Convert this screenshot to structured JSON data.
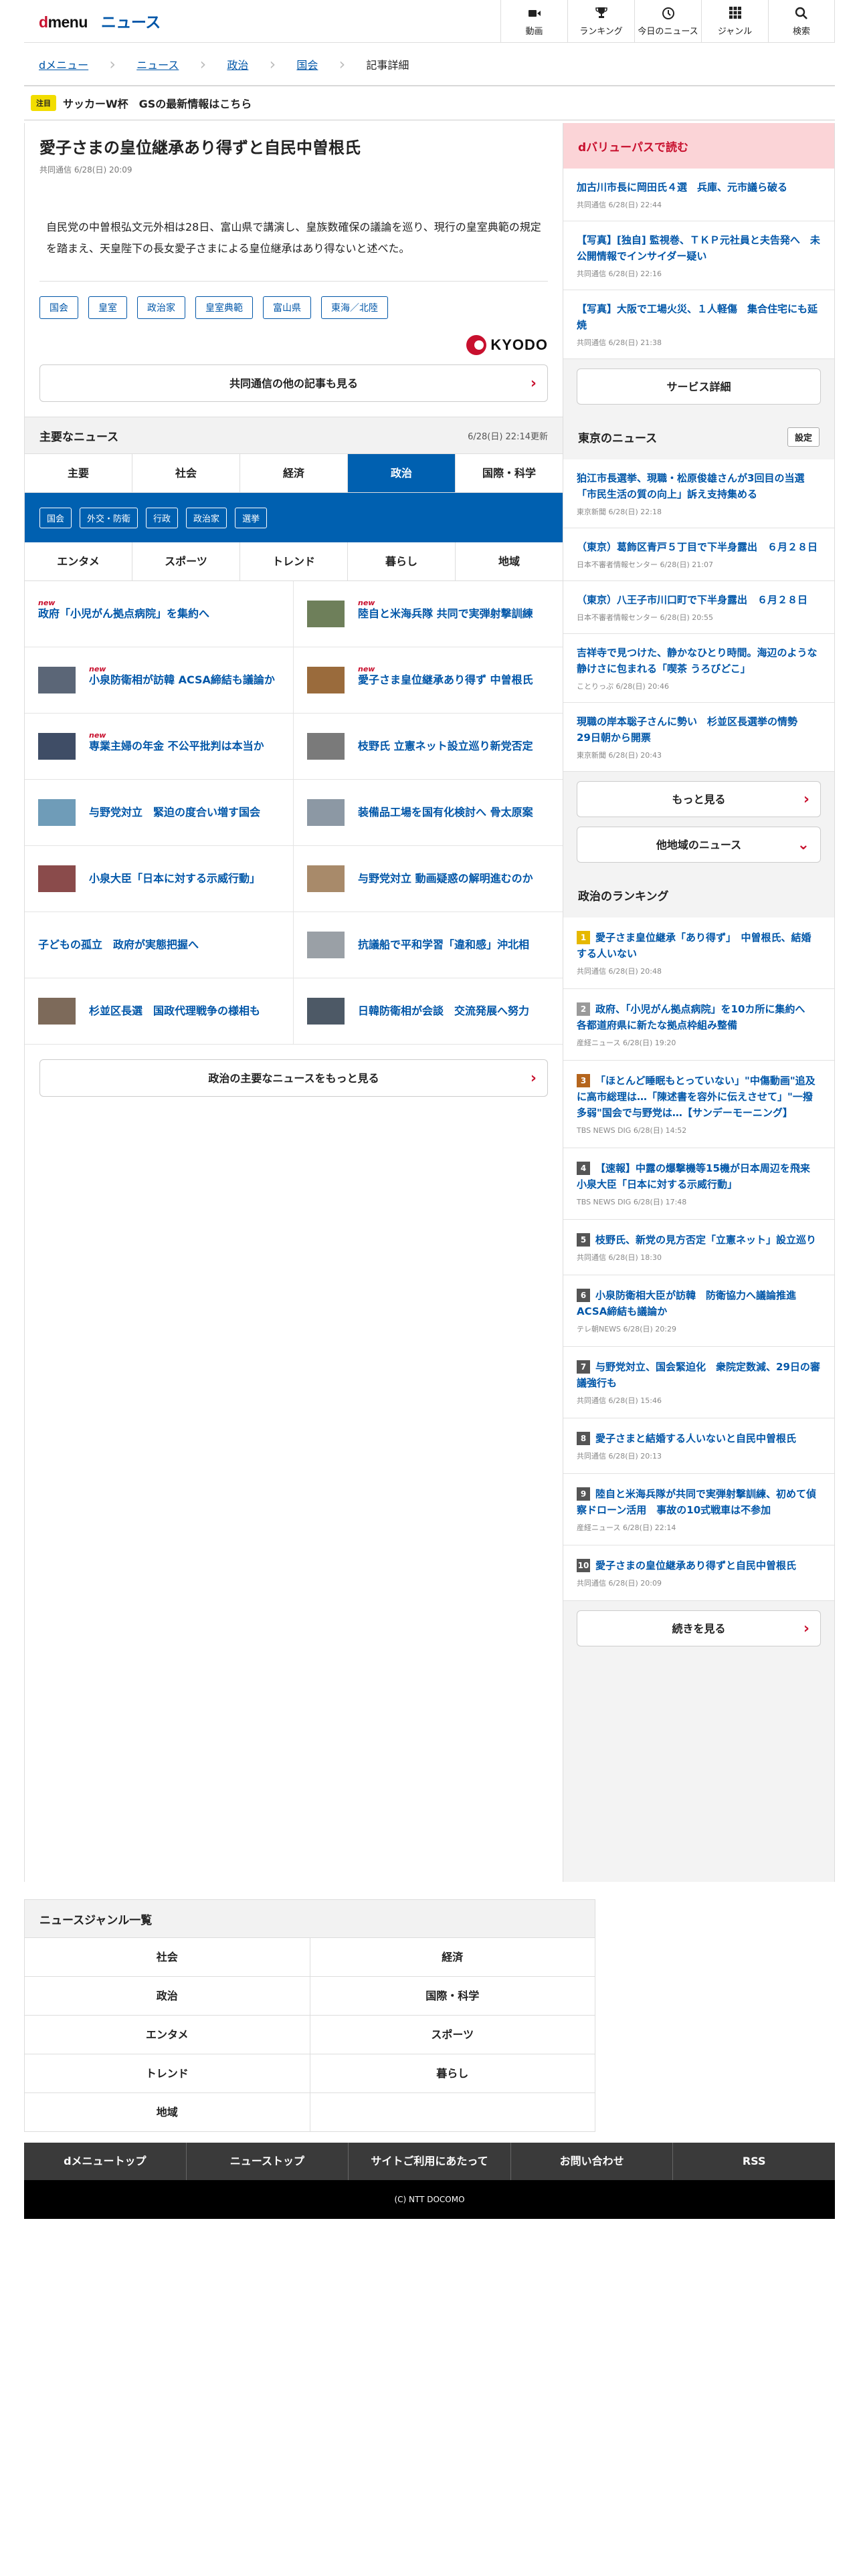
{
  "header": {
    "logo_d": "d",
    "logo_menu": "menu",
    "service": "ニュース",
    "nav": [
      {
        "icon": "video-icon",
        "label": "動画"
      },
      {
        "icon": "trophy-icon",
        "label": "ランキング"
      },
      {
        "icon": "clock-icon",
        "label": "今日のニュース"
      },
      {
        "icon": "grid-icon",
        "label": "ジャンル"
      },
      {
        "icon": "search-icon",
        "label": "検索"
      }
    ]
  },
  "breadcrumb": [
    "dメニュー",
    "ニュース",
    "政治",
    "国会",
    "記事詳細"
  ],
  "notice": {
    "tag": "注目",
    "text": "サッカーW杯　GSの最新情報はこちら"
  },
  "article": {
    "title": "愛子さまの皇位継承あり得ずと自民中曽根氏",
    "meta": "共同通信 6/28(日) 20:09",
    "lead": "自民党の中曽根弘文元外相は28日、富山県で講演し、皇族数確保の議論を巡り、現行の皇室典範の規定を踏まえ、天皇陛下の長女愛子さまによる皇位継承はあり得ないと述べた。",
    "tags": [
      "国会",
      "皇室",
      "政治家",
      "皇室典範",
      "富山県",
      "東海／北陸"
    ],
    "provider_logo": "KYODO",
    "more_button": "共同通信の他の記事も見る"
  },
  "main_news": {
    "title": "主要なニュース",
    "updated": "6/28(日) 22:14更新",
    "tabs1": [
      "主要",
      "社会",
      "経済",
      "政治",
      "国際・科学"
    ],
    "active_tab": "政治",
    "subtags": [
      "国会",
      "外交・防衛",
      "行政",
      "政治家",
      "選挙"
    ],
    "tabs2": [
      "エンタメ",
      "スポーツ",
      "トレンド",
      "暮らし",
      "地域"
    ],
    "items": [
      {
        "title": "政府「小児がん拠点病院」を集約へ",
        "new": "new",
        "thumb": false,
        "color": ""
      },
      {
        "title": "陸自と米海兵隊 共同で実弾射撃訓練",
        "new": "new",
        "thumb": true,
        "color": "#6e7f5a"
      },
      {
        "title": "小泉防衛相が訪韓 ACSA締結も議論か",
        "new": "new",
        "thumb": true,
        "color": "#5b6677"
      },
      {
        "title": "愛子さま皇位継承あり得ず 中曽根氏",
        "new": "new",
        "thumb": true,
        "color": "#9a6b3c"
      },
      {
        "title": "専業主婦の年金 不公平批判は本当か",
        "new": "new",
        "thumb": true,
        "color": "#3f4d66"
      },
      {
        "title": "枝野氏 立憲ネット設立巡り新党否定",
        "new": "",
        "thumb": true,
        "color": "#7a7a7a"
      },
      {
        "title": "与野党対立　緊迫の度合い増す国会",
        "new": "",
        "thumb": true,
        "color": "#6f9cb8"
      },
      {
        "title": "装備品工場を国有化検討へ 骨太原案",
        "new": "",
        "thumb": true,
        "color": "#8c98a4"
      },
      {
        "title": "小泉大臣「日本に対する示威行動」",
        "new": "",
        "thumb": true,
        "color": "#8a4b4b"
      },
      {
        "title": "与野党対立 動画疑惑の解明進むのか",
        "new": "",
        "thumb": true,
        "color": "#a88a6a"
      },
      {
        "title": "子どもの孤立　政府が実態把握へ",
        "new": "",
        "thumb": false,
        "color": ""
      },
      {
        "title": "抗議船で平和学習「違和感」沖北相",
        "new": "",
        "thumb": true,
        "color": "#9aa0a6"
      },
      {
        "title": "杉並区長選　国政代理戦争の様相も",
        "new": "",
        "thumb": true,
        "color": "#7d6a5a"
      },
      {
        "title": "日韓防衛相が会談　交流発展へ努力",
        "new": "",
        "thumb": true,
        "color": "#4d5966"
      }
    ],
    "more_button": "政治の主要なニュースをもっと見る"
  },
  "dvalue": {
    "title": "dバリューパスで読む",
    "items": [
      {
        "title": "加古川市長に岡田氏４選　兵庫、元市議ら破る",
        "meta": "共同通信 6/28(日) 22:44"
      },
      {
        "title": "【写真】[独自] 監視巻、ＴＫＰ元社員と夫告発へ　未公開情報でインサイダー疑い",
        "meta": "共同通信 6/28(日) 22:16"
      },
      {
        "title": "【写真】大阪で工場火災、１人軽傷　集合住宅にも延焼",
        "meta": "共同通信 6/28(日) 21:38"
      }
    ],
    "button": "サービス詳細"
  },
  "tokyo": {
    "title": "東京のニュース",
    "setting": "設定",
    "items": [
      {
        "title": "狛江市長選挙、現職・松原俊雄さんが3回目の当選「市民生活の質の向上」訴え支持集める",
        "meta": "東京新聞 6/28(日) 22:18"
      },
      {
        "title": "（東京）葛飾区青戸５丁目で下半身露出　６月２８日",
        "meta": "日本不審者情報センター 6/28(日) 21:07"
      },
      {
        "title": "（東京）八王子市川口町で下半身露出　６月２８日",
        "meta": "日本不審者情報センター 6/28(日) 20:55"
      },
      {
        "title": "吉祥寺で見つけた、静かなひとり時間。海辺のような静けさに包まれる「喫茶 うろびどこ」",
        "meta": "ことりっぷ 6/28(日) 20:46"
      },
      {
        "title": "現職の岸本聡子さんに勢い　杉並区長選挙の情勢　29日朝から開票",
        "meta": "東京新聞 6/28(日) 20:43"
      }
    ],
    "more_button": "もっと見る",
    "other_button": "他地域のニュース"
  },
  "ranking": {
    "title": "政治のランキング",
    "items": [
      {
        "rank": "1",
        "color": "#e6b800",
        "title": "愛子さま皇位継承「あり得ず」　中曽根氏、結婚する人いない",
        "meta": "共同通信 6/28(日) 20:48"
      },
      {
        "rank": "2",
        "color": "#9a9a9a",
        "title": "政府、「小児がん拠点病院」を10カ所に集約へ　各都道府県に新たな拠点枠組み整備",
        "meta": "産経ニュース 6/28(日) 19:20"
      },
      {
        "rank": "3",
        "color": "#b5651d",
        "title": "「ほとんど睡眠もとっていない」\"中傷動画\"追及に高市総理は…「陳述書を容外に伝えさせて」\"一撥多弱\"国会で与野党は…【サンデーモーニング】",
        "meta": "TBS NEWS DIG 6/28(日) 14:52"
      },
      {
        "rank": "4",
        "color": "#555555",
        "title": "【速報】中露の爆撃機等15機が日本周辺を飛来　小泉大臣「日本に対する示威行動」",
        "meta": "TBS NEWS DIG 6/28(日) 17:48"
      },
      {
        "rank": "5",
        "color": "#555555",
        "title": "枝野氏、新党の見方否定「立憲ネット」設立巡り",
        "meta": "共同通信 6/28(日) 18:30"
      },
      {
        "rank": "6",
        "color": "#555555",
        "title": "小泉防衛相大臣が訪韓　防衛協力へ議論推進 ACSA締結も議論か",
        "meta": "テレ朝NEWS 6/28(日) 20:29"
      },
      {
        "rank": "7",
        "color": "#555555",
        "title": "与野党対立、国会緊迫化　衆院定数減、29日の審議強行も",
        "meta": "共同通信 6/28(日) 15:46"
      },
      {
        "rank": "8",
        "color": "#555555",
        "title": "愛子さまと結婚する人いないと自民中曽根氏",
        "meta": "共同通信 6/28(日) 20:13"
      },
      {
        "rank": "9",
        "color": "#555555",
        "title": "陸自と米海兵隊が共同で実弾射撃訓練、初めて偵察ドローン活用　事故の10式戦車は不参加",
        "meta": "産経ニュース 6/28(日) 22:14"
      },
      {
        "rank": "10",
        "color": "#555555",
        "title": "愛子さまの皇位継承あり得ずと自民中曽根氏",
        "meta": "共同通信 6/28(日) 20:09"
      }
    ],
    "more_button": "続きを見る"
  },
  "genre": {
    "title": "ニュースジャンル一覧",
    "items": [
      "社会",
      "経済",
      "政治",
      "国際・科学",
      "エンタメ",
      "スポーツ",
      "トレンド",
      "暮らし",
      "地域",
      ""
    ]
  },
  "footer": {
    "nav": [
      "dメニュートップ",
      "ニューストップ",
      "サイトご利用にあたって",
      "お問い合わせ",
      "RSS"
    ],
    "copyright": "(C) NTT DOCOMO"
  }
}
